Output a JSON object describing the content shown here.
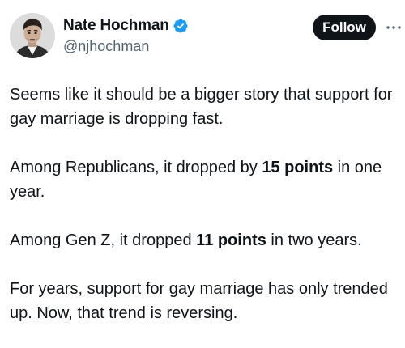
{
  "author": {
    "display_name": "Nate Hochman",
    "handle": "@njhochman",
    "verified_icon": "verified-badge-icon",
    "avatar_icon": "avatar"
  },
  "actions": {
    "follow_label": "Follow",
    "more_icon": "more-options-icon"
  },
  "post": {
    "p1": "Seems like it should be a bigger story that support for gay marriage is dropping fast.",
    "p2_before": "Among Republicans, it dropped by ",
    "p2_bold": "15 points",
    "p2_after": " in one year.",
    "p3_before": "Among Gen Z, it dropped ",
    "p3_bold": "11 points",
    "p3_after": " in two years.",
    "p4": "For years, support for gay marriage has only trended up. Now, that trend is reversing."
  },
  "colors": {
    "text": "#0f1419",
    "secondary": "#536471",
    "verified": "#1d9bf0",
    "button_bg": "#0f1419",
    "button_text": "#ffffff"
  }
}
